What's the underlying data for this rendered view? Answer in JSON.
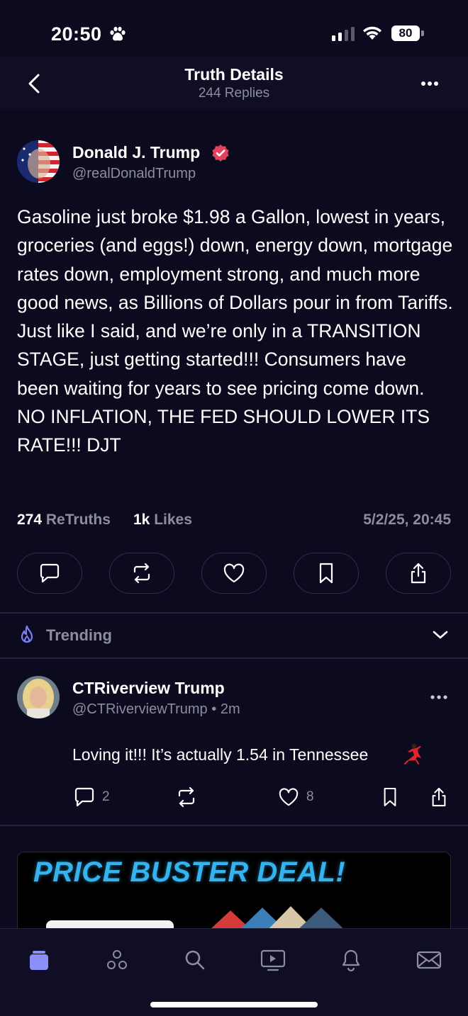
{
  "status_bar": {
    "time": "20:50",
    "battery": "80",
    "icons": [
      "paw-icon",
      "signal-icon",
      "wifi-icon",
      "battery-icon"
    ]
  },
  "header": {
    "title": "Truth Details",
    "subtitle": "244 Replies",
    "icons": [
      "chevron-left-icon",
      "more-icon"
    ]
  },
  "post": {
    "author_name": "Donald J. Trump",
    "handle": "@realDonaldTrump",
    "verified_color": "#e0445c",
    "body": "Gasoline just broke $1.98 a Gallon, lowest in years, groceries (and eggs!) down, energy down, mortgage rates down, employment strong, and much more good news, as Billions of Dollars pour in from Tariffs. Just like I said, and we’re only in a TRANSITION STAGE, just getting started!!! Consumers have been waiting for years to see pricing come down. NO INFLATION, THE FED SHOULD LOWER ITS RATE!!! DJT",
    "retruths_count": "274",
    "retruths_label": "ReTruths",
    "likes_count": "1k",
    "likes_label": "Likes",
    "date": "5/2/25, 20:45",
    "actions": [
      "comment-icon",
      "retruth-icon",
      "heart-icon",
      "bookmark-icon",
      "share-icon"
    ]
  },
  "trending": {
    "label": "Trending",
    "accent": "#7b7ff5"
  },
  "reply": {
    "author_name": "CTRiverview Trump",
    "handle": "@CTRiverviewTrump",
    "separator": "•",
    "time": "2m",
    "text": "Loving it!!! It’s actually 1.54 in Tennessee",
    "comment_count": "2",
    "like_count": "8"
  },
  "ad": {
    "headline": "PRICE BUSTER DEAL!",
    "headline_color": "#35b3ee"
  },
  "tabbar": {
    "tabs": [
      "home-icon",
      "groups-icon",
      "search-icon",
      "video-icon",
      "notifications-icon",
      "messages-icon"
    ],
    "active_color": "#8b8ff8"
  }
}
